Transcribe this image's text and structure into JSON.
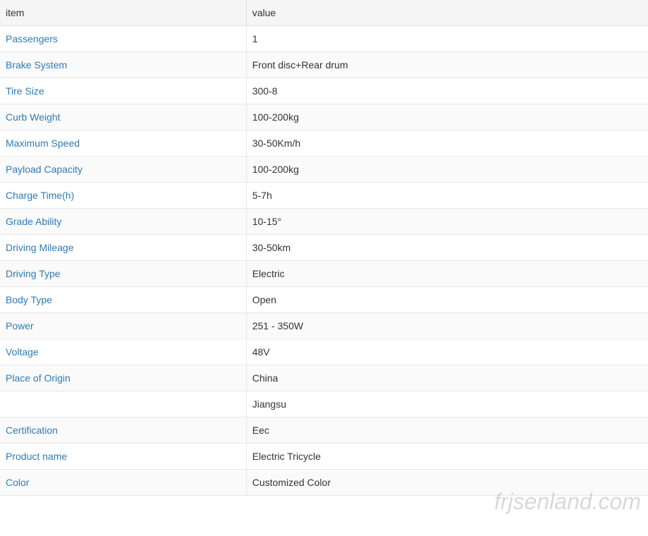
{
  "table": {
    "header": {
      "item_col": "item",
      "value_col": "value"
    },
    "rows": [
      {
        "item": "Passengers",
        "value": "1"
      },
      {
        "item": "Brake System",
        "value": "Front disc+Rear drum"
      },
      {
        "item": "Tire Size",
        "value": "300-8"
      },
      {
        "item": "Curb Weight",
        "value": "100-200kg"
      },
      {
        "item": "Maximum Speed",
        "value": "30-50Km/h"
      },
      {
        "item": "Payload Capacity",
        "value": "100-200kg"
      },
      {
        "item": "Charge Time(h)",
        "value": "5-7h"
      },
      {
        "item": "Grade Ability",
        "value": "10-15°"
      },
      {
        "item": "Driving Mileage",
        "value": "30-50km"
      },
      {
        "item": "Driving Type",
        "value": "Electric"
      },
      {
        "item": "Body Type",
        "value": "Open"
      },
      {
        "item": "Power",
        "value": "251 - 350W"
      },
      {
        "item": "Voltage",
        "value": "48V"
      },
      {
        "item": "Place of Origin",
        "value": "China"
      },
      {
        "item": "",
        "value": "Jiangsu"
      },
      {
        "item": "Certification",
        "value": "Eec"
      },
      {
        "item": "Product name",
        "value": "Electric Tricycle"
      },
      {
        "item": "Color",
        "value": "Customized Color"
      }
    ]
  },
  "watermark": "frjsenland.com"
}
